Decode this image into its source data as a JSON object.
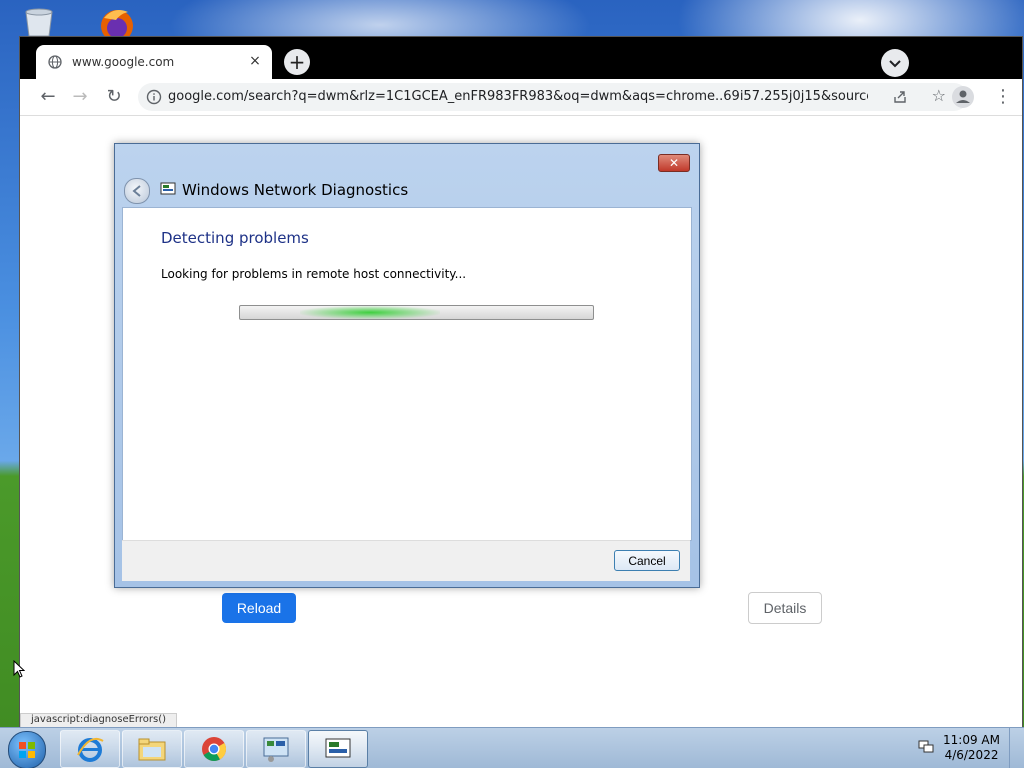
{
  "browser": {
    "tab_title": "www.google.com",
    "tab_close": "×",
    "new_tab": "+",
    "url": "google.com/search?q=dwm&rlz=1C1GCEA_enFR983FR983&oq=dwm&aqs=chrome..69i57.255j0j15&sourceid=...",
    "back": "←",
    "forward": "→",
    "reload": "↻",
    "menu": "⋮"
  },
  "page": {
    "reload_button": "Reload",
    "details_button": "Details",
    "status_text": "javascript:diagnoseErrors()"
  },
  "dialog": {
    "title": "Windows Network Diagnostics",
    "close": "✕",
    "heading": "Detecting problems",
    "message": "Looking for problems in remote host connectivity...",
    "cancel": "Cancel",
    "progress_indicator": "indeterminate"
  },
  "taskbar": {
    "time": "11:09 AM",
    "date": "4/6/2022",
    "items": [
      {
        "name": "Internet Explorer"
      },
      {
        "name": "Windows Explorer"
      },
      {
        "name": "Google Chrome"
      },
      {
        "name": "Control Panel"
      },
      {
        "name": "Windows Network Diagnostics",
        "active": true
      }
    ]
  },
  "colors": {
    "chrome_blue": "#1a73e8",
    "dialog_heading": "#1e3287",
    "progress_green": "#3ecf3e"
  }
}
